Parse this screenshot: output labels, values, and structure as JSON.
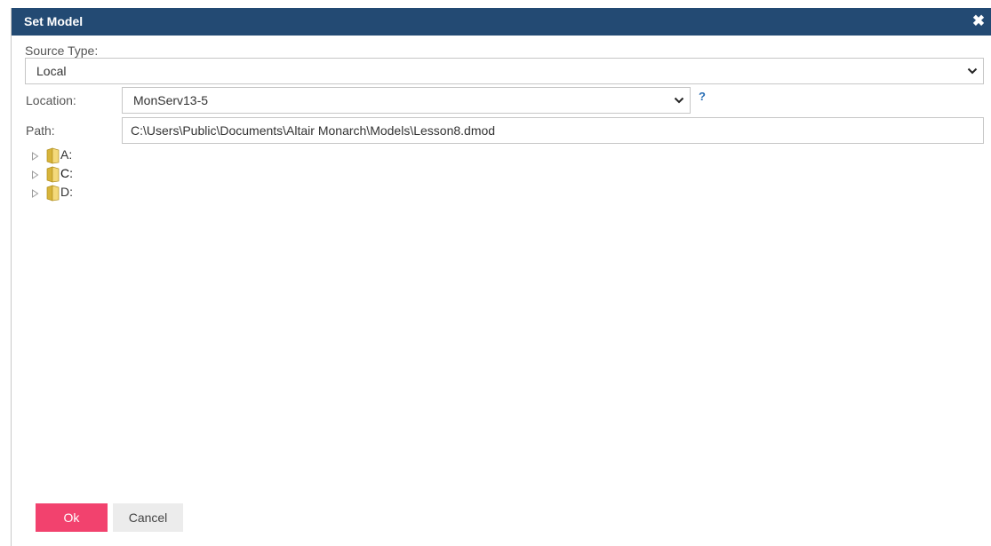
{
  "dialog": {
    "title": "Set Model",
    "close_icon": "close-icon",
    "title_bar_color": "#234a73"
  },
  "form": {
    "source_type": {
      "label": "Source Type:",
      "value": "Local"
    },
    "location": {
      "label": "Location:",
      "value": "MonServ13-5",
      "help": "?"
    },
    "path": {
      "label": "Path:",
      "value": "C:\\Users\\Public\\Documents\\Altair Monarch\\Models\\Lesson8.dmod"
    }
  },
  "tree": {
    "items": [
      {
        "label": "A:",
        "icon": "folder-icon",
        "expander": "expand-arrow-icon"
      },
      {
        "label": "C:",
        "icon": "folder-icon",
        "expander": "expand-arrow-icon"
      },
      {
        "label": "D:",
        "icon": "folder-icon",
        "expander": "expand-arrow-icon"
      }
    ]
  },
  "buttons": {
    "ok_label": "Ok",
    "ok_color": "#f2426e",
    "cancel_label": "Cancel"
  }
}
